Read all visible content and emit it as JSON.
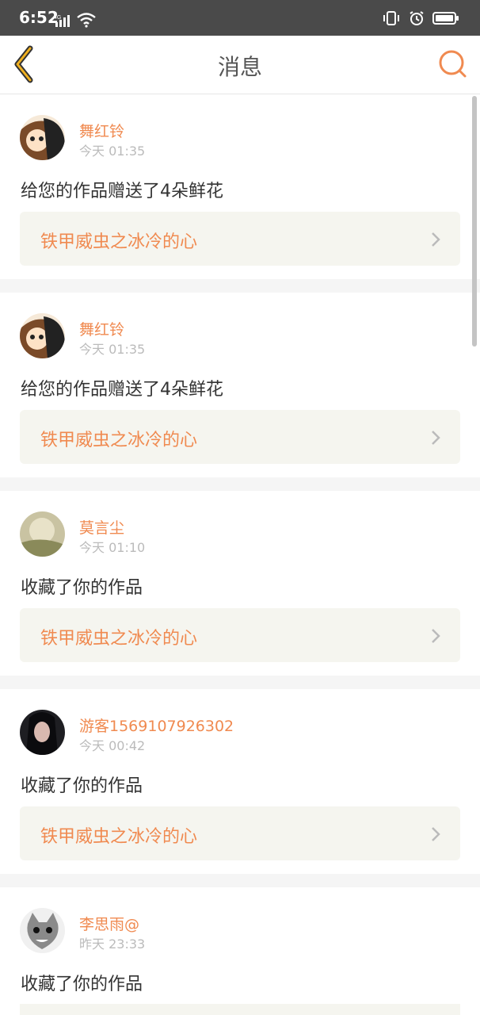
{
  "status_bar": {
    "time": "6:52",
    "network": "4G"
  },
  "header": {
    "title": "消息"
  },
  "messages": [
    {
      "username": "舞红铃",
      "time": "今天 01:35",
      "text": "给您的作品赠送了4朵鲜花",
      "work_title": "铁甲威虫之冰冷的心"
    },
    {
      "username": "舞红铃",
      "time": "今天 01:35",
      "text": "给您的作品赠送了4朵鲜花",
      "work_title": "铁甲威虫之冰冷的心"
    },
    {
      "username": "莫言尘",
      "time": "今天 01:10",
      "text": "收藏了你的作品",
      "work_title": "铁甲威虫之冰冷的心"
    },
    {
      "username": "游客1569107926302",
      "time": "今天 00:42",
      "text": "收藏了你的作品",
      "work_title": "铁甲威虫之冰冷的心"
    },
    {
      "username": "李思雨@",
      "time": "昨天 23:33",
      "text": "收藏了你的作品",
      "work_title": ""
    }
  ],
  "colors": {
    "accent": "#f08a50",
    "back_arrow": "#f0b020",
    "link_bg": "#f5f5ef"
  }
}
